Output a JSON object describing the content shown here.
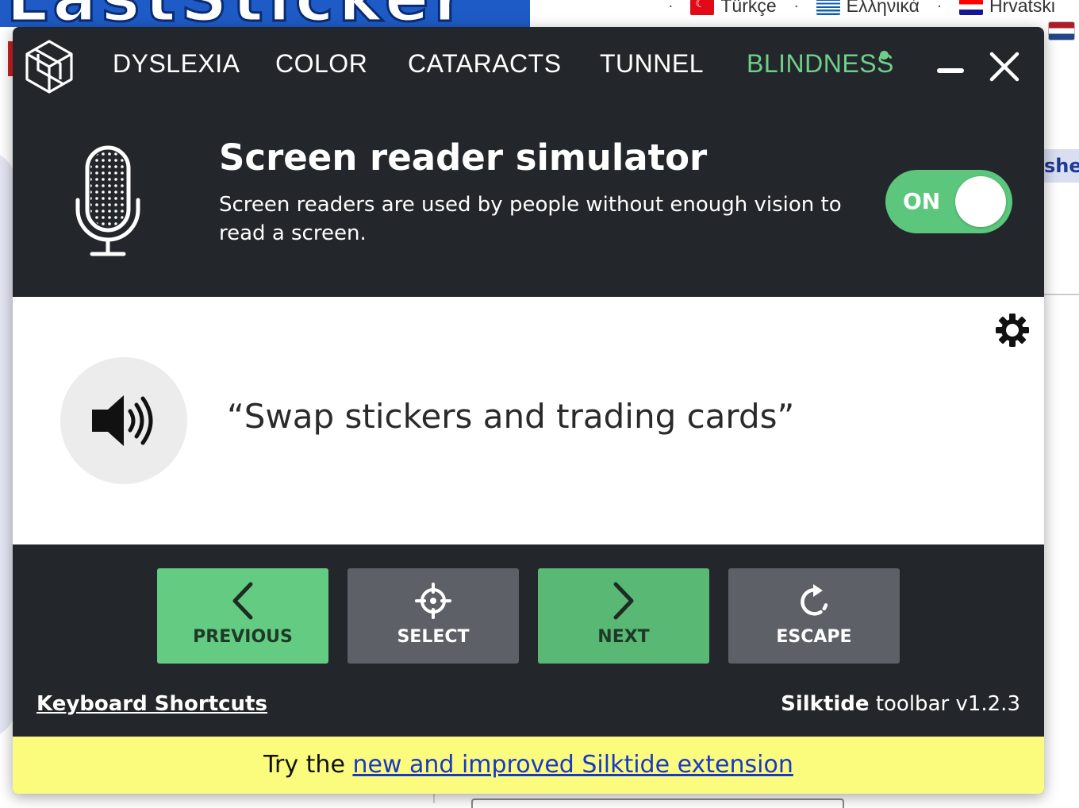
{
  "background_site": {
    "logo_text": "LastSticker",
    "languages": [
      "Türkçe",
      "Ελληνικά",
      "Hrvatski"
    ],
    "right_tag": "she"
  },
  "toolbar": {
    "tabs": [
      {
        "label": "DYSLEXIA",
        "active": false
      },
      {
        "label": "COLOR",
        "active": false
      },
      {
        "label": "CATARACTS",
        "active": false
      },
      {
        "label": "TUNNEL",
        "active": false
      },
      {
        "label": "BLINDNESS",
        "active": true
      }
    ],
    "minimize_icon": "minimize-icon",
    "close_icon": "close-icon",
    "accent_color": "#6fcf8a",
    "panel_color": "#23272c"
  },
  "hero": {
    "title": "Screen reader simulator",
    "description": "Screen readers are used by people without enough vision to read a screen.",
    "toggle_label": "ON",
    "toggle_state": "on"
  },
  "output": {
    "spoken_text": "“Swap stickers and trading cards”",
    "settings_icon": "gear-icon",
    "speaker_icon": "speaker-icon"
  },
  "controls": [
    {
      "label": "PREVIOUS",
      "icon": "chevron-left-icon"
    },
    {
      "label": "SELECT",
      "icon": "crosshair-icon"
    },
    {
      "label": "NEXT",
      "icon": "chevron-right-icon"
    },
    {
      "label": "ESCAPE",
      "icon": "rotate-icon"
    }
  ],
  "footer": {
    "shortcuts_link": "Keyboard Shortcuts",
    "brand": "Silktide",
    "version_text": " toolbar v1.2.3"
  },
  "promo": {
    "prefix": "Try the ",
    "link": "new and improved Silktide extension"
  }
}
